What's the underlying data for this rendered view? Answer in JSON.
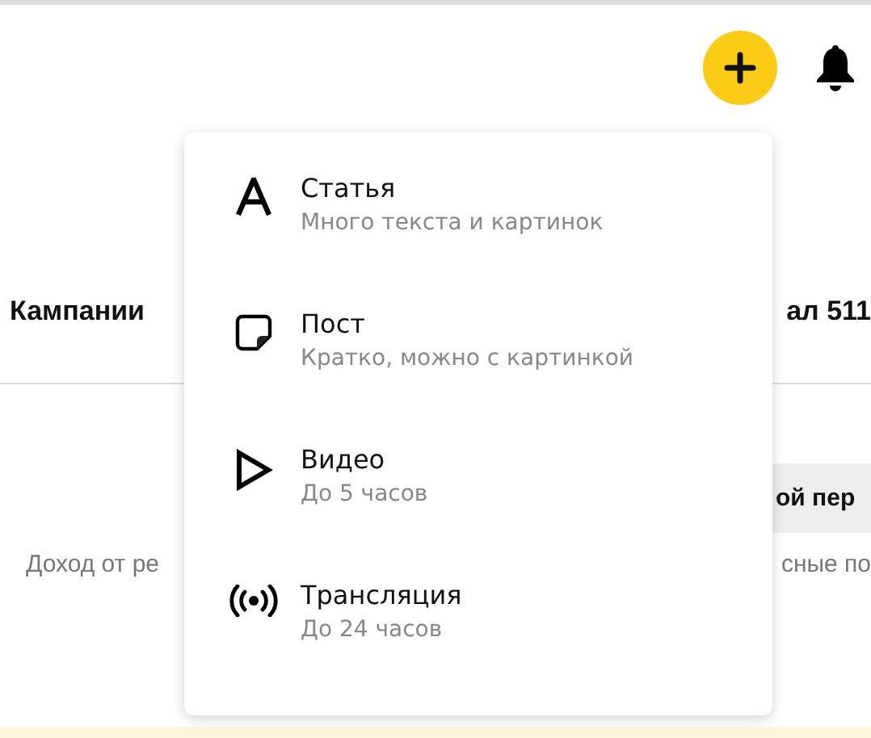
{
  "tabs": [
    {
      "label": "Кампании"
    },
    {
      "label": "ал 511"
    }
  ],
  "period_button": {
    "label": "ой пер"
  },
  "income_text": {
    "left": "Доход от ре",
    "right": "сные по"
  },
  "create_menu": {
    "items": [
      {
        "kind": "article",
        "title": "Статья",
        "subtitle": "Много текста и картинок"
      },
      {
        "kind": "post",
        "title": "Пост",
        "subtitle": "Кратко, можно с картинкой"
      },
      {
        "kind": "video",
        "title": "Видео",
        "subtitle": "До 5 часов"
      },
      {
        "kind": "stream",
        "title": "Трансляция",
        "subtitle": "До 24 часов"
      }
    ]
  }
}
